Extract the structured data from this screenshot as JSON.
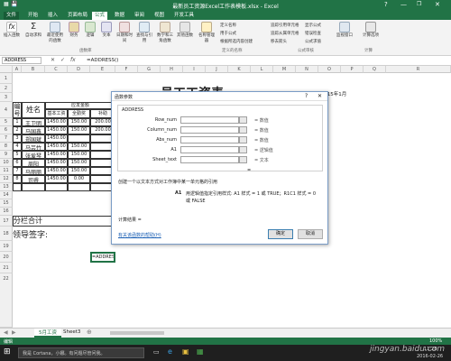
{
  "window": {
    "title": "最新员工资源Excel工作表模板.xlsx - Excel",
    "help": "?",
    "minimize": "—",
    "restore": "❐",
    "close": "✕"
  },
  "ribbon_tabs": [
    "文件",
    "开始",
    "插入",
    "页面布局",
    "公式",
    "数据",
    "审阅",
    "视图",
    "开发工具"
  ],
  "active_tab": "公式",
  "ribbon": {
    "insert_function": "插入函数",
    "autosum": "自动求和",
    "recent": "最近使用的函数",
    "financial": "财务",
    "logical": "逻辑",
    "text": "文本",
    "datetime": "日期和时间",
    "lookup": "查找与引用",
    "math": "数学和三角函数",
    "other": "其他函数",
    "library_group": "函数库",
    "name_manager": "名称管理器",
    "define_name": "定义名称",
    "use_in_formula": "用于公式",
    "create_from_selection": "根据所选内容创建",
    "names_group": "定义的名称",
    "trace_precedents": "追踪引用单元格",
    "trace_dependents": "追踪从属单元格",
    "remove_arrows": "移去箭头",
    "show_formulas": "显示公式",
    "error_checking": "错误检查",
    "evaluate_formula": "公式求值",
    "audit_group": "公式审核",
    "watch_window": "监视窗口",
    "calc_options": "计算选项",
    "calc_group": "计算"
  },
  "formula_bar": {
    "name_box": "ADDRESS",
    "cancel": "✕",
    "enter": "✓",
    "fx": "fx",
    "formula": "=ADDRESS()"
  },
  "columns": [
    "A",
    "B",
    "C",
    "D",
    "E",
    "F",
    "G",
    "H",
    "I",
    "J",
    "K",
    "L",
    "M",
    "N",
    "O",
    "P",
    "Q",
    "R"
  ],
  "rows": [
    "1",
    "2",
    "3",
    "4",
    "5",
    "6",
    "7",
    "8",
    "9",
    "10",
    "11",
    "12",
    "13",
    "14",
    "15",
    "16",
    "17",
    "18",
    "19",
    "20",
    "21",
    "22"
  ],
  "sheet": {
    "title": "员工工资表",
    "issue_date": "发放日期：2015年2月12日  所属日期：2015年1月",
    "header_no": "编号",
    "header_name": "姓名",
    "header_should": "应发金额",
    "header_base": "基本工资",
    "header_bonus": "全勤奖",
    "header_sub": "补助",
    "employees": [
      {
        "no": "1",
        "name": "王卫明",
        "base": "1450.00",
        "bonus": "150.00",
        "sub": "200.00"
      },
      {
        "no": "2",
        "name": "马国鑫",
        "base": "1450.00",
        "bonus": "150.00",
        "sub": "200.00"
      },
      {
        "no": "3",
        "name": "郑国斌",
        "base": "1450.00",
        "bonus": "",
        "sub": ""
      },
      {
        "no": "4",
        "name": "马芸竹",
        "base": "1450.00",
        "bonus": "150.00",
        "sub": ""
      },
      {
        "no": "5",
        "name": "张爱琴",
        "base": "1450.00",
        "bonus": "150.00",
        "sub": ""
      },
      {
        "no": "6",
        "name": "周阳",
        "base": "1450.00",
        "bonus": "150.00",
        "sub": ""
      },
      {
        "no": "7",
        "name": "马丽丽",
        "base": "1450.00",
        "bonus": "150.00",
        "sub": ""
      },
      {
        "no": "8",
        "name": "司睿",
        "base": "1450.00",
        "bonus": "0.00",
        "sub": ""
      }
    ],
    "subtotal": "分栏合计",
    "signature": "领导签字:",
    "active_cell": "=ADDRESS()"
  },
  "dialog": {
    "title": "函数参数",
    "help": "?",
    "close": "✕",
    "function": "ADDRESS",
    "args": [
      {
        "label": "Row_num",
        "hint": "= 数值"
      },
      {
        "label": "Column_num",
        "hint": "= 数值"
      },
      {
        "label": "Abs_num",
        "hint": "= 数值"
      },
      {
        "label": "A1",
        "hint": "= 逻辑值"
      },
      {
        "label": "Sheet_text",
        "hint": "= 文本"
      }
    ],
    "eq_result": "=",
    "description": "创建一个以文本方式对工作簿中某一单元格的引用",
    "arg_desc_name": "A1",
    "arg_desc": "用逻辑值指定引用样式: A1 样式 = 1 或 TRUE；R1C1 样式 = 0 或 FALSE",
    "calc_result": "计算结果 =",
    "help_link": "有关该函数的帮助(H)",
    "ok": "确定",
    "cancel": "取消"
  },
  "sheet_tabs": {
    "tab1": "5月工资",
    "tab2": "Sheet3",
    "add": "⊕"
  },
  "status": {
    "mode": "编辑",
    "zoom": "100%"
  },
  "taskbar": {
    "search": "我是 Cortana，小娜。有问题尽管问我。",
    "time": "11:28",
    "date": "2016-02-26",
    "watermark": "jingyan.baidu.com"
  },
  "colors": {
    "excel_green": "#217346",
    "dialog_border": "#7a9cc6"
  }
}
